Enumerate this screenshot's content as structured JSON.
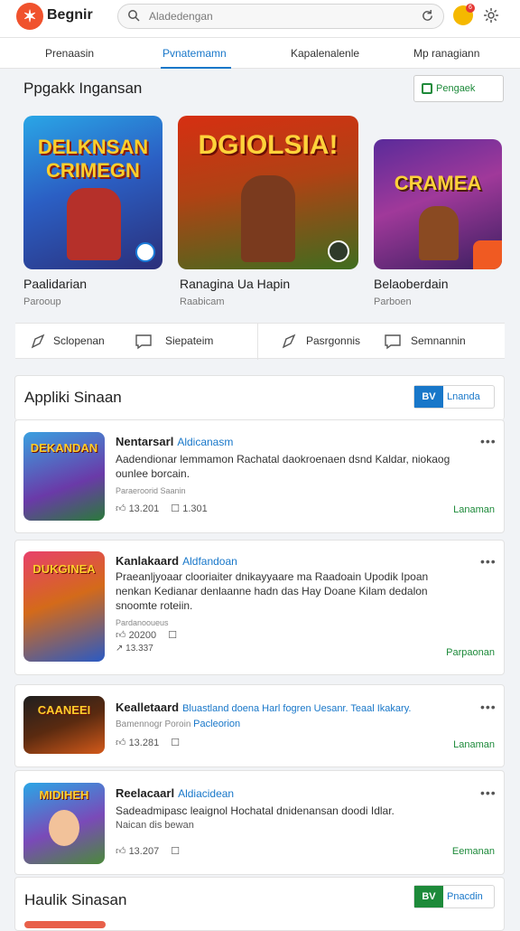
{
  "header": {
    "brand": "Begnir",
    "search_placeholder": "Aladedengan",
    "notification_count": "6"
  },
  "tabs": [
    {
      "label": "Prenaasin",
      "active": false
    },
    {
      "label": "Pvnatemamn",
      "active": true
    },
    {
      "label": "Kapalenalenle",
      "active": false
    },
    {
      "label": "Mp ranagiann",
      "active": false
    }
  ],
  "featured": {
    "heading": "Ppgakk Ingansan",
    "button_label": "Pengaek",
    "items": [
      {
        "title": "Paalidarian",
        "subtitle": "Parooup",
        "art_text": "DELKNSAN CRIMEGN"
      },
      {
        "title": "Ranagina Ua Hapin",
        "subtitle": "Raabicam",
        "art_text": "DGIOLSIA!"
      },
      {
        "title": "Belaoberdain",
        "subtitle": "Parboen",
        "art_text": "CRAMEA"
      }
    ],
    "actions": [
      "Sclopenan",
      "Siepateim",
      "Pasrgonnis",
      "Semnannin"
    ]
  },
  "list_section": {
    "heading": "Appliki Sinaan",
    "button_label": "Lnanda",
    "button_badge": "BV",
    "items": [
      {
        "title": "Nentarsarl",
        "author": "Aldicanasm",
        "description": "Aadendionar lemmamon Rachatal daokroenaen dsnd Kaldar, niokaog ounlee borcain.",
        "meta": "Paraeroorid Saanin",
        "likes": "13.201",
        "comments": "1.301",
        "action": "Lanaman",
        "art_text": "DEKANDAN"
      },
      {
        "title": "Kanlakaard",
        "author": "Aldfandoan",
        "description": "Praeanljyoaar clooriaiter dnikayyaare ma Raadoain Upodik Ipoan nenkan Kedianar denlaanne hadn das Hay Doane Kilam dedalon snoomte roteiin.",
        "meta": "Pardanooueus",
        "likes": "20200",
        "comments": "13.337",
        "action": "Parpaonan",
        "art_text": "DUKGINEA"
      },
      {
        "title": "Kealletaard",
        "author": "Bluastland doena Harl fogren Uesanr. Teaal Ikakary.",
        "description": "",
        "meta": "Bamennogr Poroin",
        "meta_link": "Pacleorion",
        "likes": "13.281",
        "comments": "",
        "action": "Lanaman",
        "art_text": "CAANEEI"
      },
      {
        "title": "Reelacaarl",
        "author": "Aldiacidean",
        "description": "Sadeadmipasc leaignol Hochatal dnidenansan doodi Idlar.",
        "meta": "Naican dis bewan",
        "likes": "13.207",
        "comments": "",
        "action": "Eemanan",
        "art_text": "MIDIHEH"
      }
    ]
  },
  "footer_section": {
    "heading": "Haulik Sinasan",
    "button_label": "Pnacdin",
    "button_badge": "BV"
  },
  "colors": {
    "accent": "#1877c9",
    "green": "#1d8a3a",
    "brand": "#f0522d"
  }
}
